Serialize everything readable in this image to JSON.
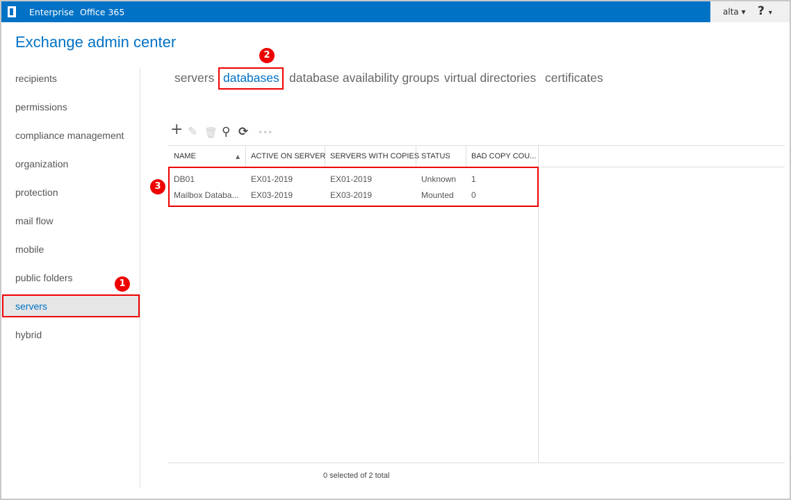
{
  "topbar": {
    "nav": [
      "Enterprise",
      "Office 365"
    ],
    "user": "alta",
    "help": "?"
  },
  "title": "Exchange admin center",
  "sidebar": {
    "items": [
      "recipients",
      "permissions",
      "compliance management",
      "organization",
      "protection",
      "mail flow",
      "mobile",
      "public folders",
      "servers",
      "hybrid"
    ],
    "selected": "servers"
  },
  "tabs": {
    "items": [
      "servers",
      "databases",
      "database availability groups",
      "virtual directories",
      "certificates"
    ],
    "active": "databases"
  },
  "toolbar": [
    "add-icon",
    "edit-icon",
    "delete-icon",
    "search-icon",
    "refresh-icon",
    "more-icon"
  ],
  "table": {
    "columns": [
      "NAME",
      "ACTIVE ON SERVER",
      "SERVERS WITH COPIES",
      "STATUS",
      "BAD COPY COU..."
    ],
    "rows": [
      [
        "DB01",
        "EX01-2019",
        "EX01-2019",
        "Unknown",
        "1"
      ],
      [
        "Mailbox Databa...",
        "EX03-2019",
        "EX03-2019",
        "Mounted",
        "0"
      ]
    ]
  },
  "footer": "0 selected of 2 total",
  "annotations": [
    "1",
    "2",
    "3"
  ],
  "colors": {
    "brand": "#0072c6",
    "annotation": "#e00000"
  }
}
